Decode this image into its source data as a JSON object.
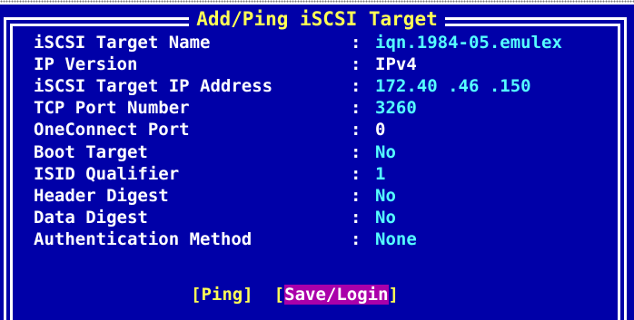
{
  "dialog": {
    "title": "Add/Ping iSCSI Target",
    "separator": ":",
    "fields": [
      {
        "label": "iSCSI Target Name",
        "value": "iqn.1984-05.emulex"
      },
      {
        "label": "IP Version",
        "value": "IPv4"
      },
      {
        "label": "iSCSI Target IP Address",
        "value": "172.40 .46 .150"
      },
      {
        "label": "TCP Port Number",
        "value": "3260"
      },
      {
        "label": "OneConnect Port",
        "value": "0"
      },
      {
        "label": "Boot Target",
        "value": "No"
      },
      {
        "label": "ISID Qualifier",
        "value": "1"
      },
      {
        "label": "Header Digest",
        "value": "No"
      },
      {
        "label": "Data Digest",
        "value": "No"
      },
      {
        "label": "Authentication Method",
        "value": "None"
      }
    ],
    "buttons": {
      "open_bracket": "[",
      "close_bracket": "]",
      "ping": "Ping",
      "save_login": "Save/Login"
    }
  },
  "colors": {
    "background": "#0000a8",
    "label": "#ffffff",
    "value": "#55ffff",
    "title": "#ffff55",
    "selected_button_bg": "#aa00aa"
  }
}
